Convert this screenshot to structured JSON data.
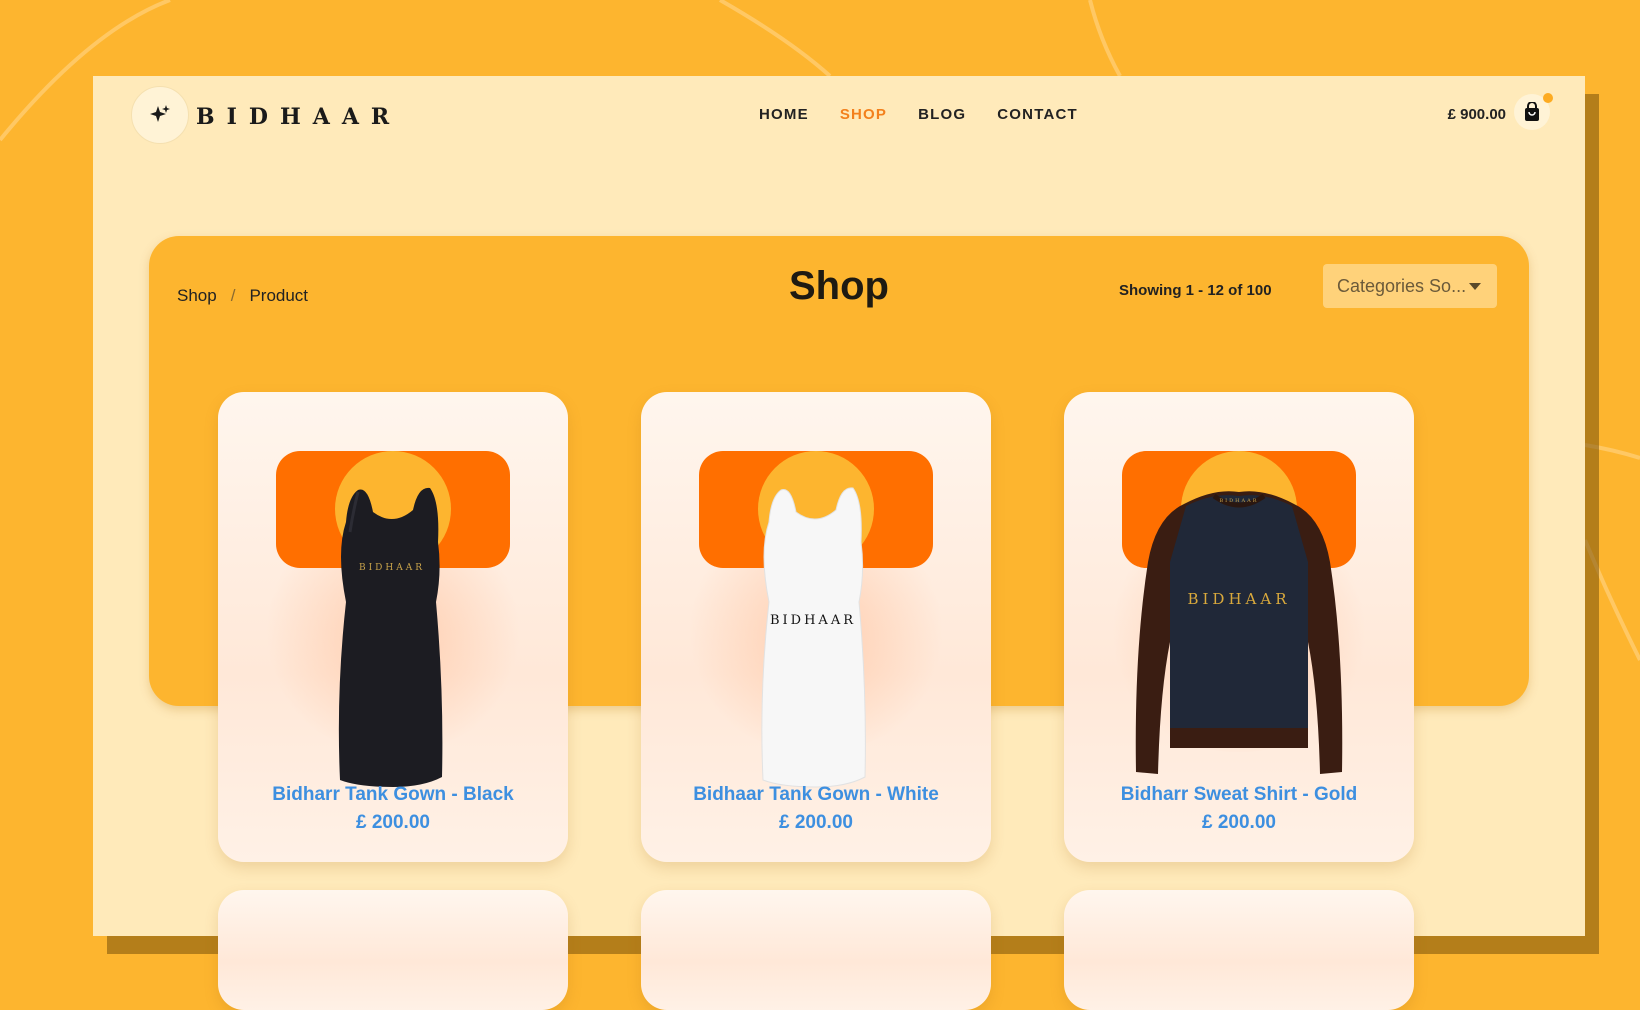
{
  "brand": {
    "name": "BIDHAAR"
  },
  "nav": {
    "items": [
      "HOME",
      "SHOP",
      "BLOG",
      "CONTACT"
    ],
    "active": "SHOP"
  },
  "cart": {
    "total": "£ 900.00"
  },
  "breadcrumb": {
    "items": [
      "Shop",
      "Product"
    ],
    "separator": "/"
  },
  "page": {
    "title": "Shop",
    "showing": "Showing 1 - 12 of 100"
  },
  "filter": {
    "categories_value": "Categories So..."
  },
  "products": [
    {
      "name": "Bidharr Tank Gown - Black",
      "price": "£ 200.00",
      "image_text": "BIDHAAR",
      "icon": "tank-gown-black"
    },
    {
      "name": "Bidhaar Tank Gown - White",
      "price": "£ 200.00",
      "image_text": "BIDHAAR",
      "icon": "tank-gown-white"
    },
    {
      "name": "Bidharr Sweat Shirt - Gold",
      "price": "£ 200.00",
      "image_text": "BIDHAAR",
      "icon": "sweatshirt"
    }
  ],
  "colors": {
    "background": "#fdb52f",
    "panel": "#ffeaba",
    "accent": "#f3801c",
    "link": "#3d8fe0",
    "badge": "#ff6f00"
  }
}
